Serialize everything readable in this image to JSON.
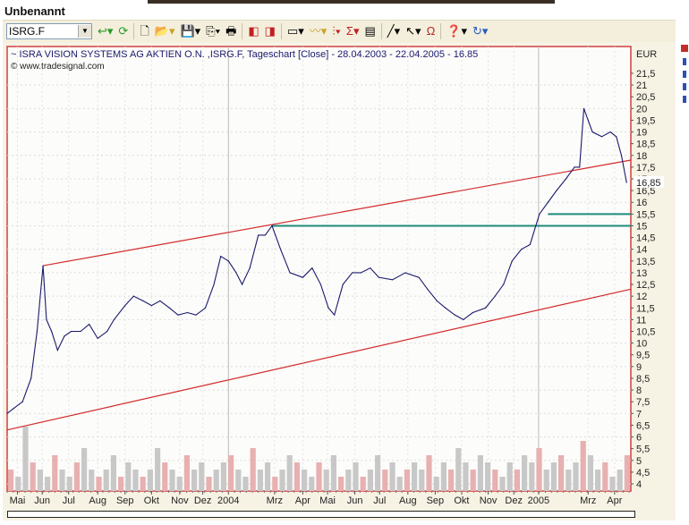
{
  "window": {
    "title": "Unbenannt"
  },
  "toolbar": {
    "symbol": "ISRG.F",
    "buttons": [
      "go",
      "refresh",
      "new",
      "open",
      "save",
      "copy",
      "print",
      "prev-chart",
      "next-chart",
      "layout",
      "indicator",
      "chart-type",
      "formula",
      "properties",
      "draw-line",
      "cursor",
      "magnet",
      "help",
      "undo"
    ]
  },
  "chart": {
    "title": "ISRA VISION SYSTEMS AG AKTIEN O.N. ,ISRG.F, Tageschart [Close] - 28.04.2003 - 22.04.2005 - 16.85",
    "source": "© www.tradesignal.com",
    "currency": "EUR",
    "last_value_label": "16,85"
  },
  "chart_data": {
    "type": "line",
    "title": "ISRA VISION SYSTEMS AG AKTIEN O.N. ,ISRG.F, Tageschart [Close]",
    "xlabel": "",
    "ylabel": "EUR",
    "ylim": [
      3.8,
      22.5
    ],
    "xlim_days": [
      0,
      730
    ],
    "yticks": [
      "21,5",
      "21",
      "20,5",
      "20",
      "19,5",
      "19",
      "18,5",
      "18",
      "17,5",
      "17",
      "16,5",
      "16",
      "15,5",
      "15",
      "14,5",
      "14",
      "13,5",
      "13",
      "12,5",
      "12",
      "11,5",
      "11",
      "10,5",
      "10",
      "9,5",
      "9",
      "8,5",
      "8",
      "7,5",
      "7",
      "6,5",
      "6",
      "5,5",
      "5",
      "4,5",
      "4"
    ],
    "xticks": [
      {
        "label": "Mai",
        "day": 12
      },
      {
        "label": "Jun",
        "day": 41
      },
      {
        "label": "Jul",
        "day": 72
      },
      {
        "label": "Aug",
        "day": 106
      },
      {
        "label": "Sep",
        "day": 138
      },
      {
        "label": "Okt",
        "day": 169
      },
      {
        "label": "Nov",
        "day": 202
      },
      {
        "label": "Dez",
        "day": 229
      },
      {
        "label": "2004",
        "day": 259
      },
      {
        "label": "Mrz",
        "day": 313
      },
      {
        "label": "Apr",
        "day": 346
      },
      {
        "label": "Mai",
        "day": 375
      },
      {
        "label": "Jun",
        "day": 407
      },
      {
        "label": "Jul",
        "day": 436
      },
      {
        "label": "Aug",
        "day": 469
      },
      {
        "label": "Sep",
        "day": 501
      },
      {
        "label": "Okt",
        "day": 532
      },
      {
        "label": "Nov",
        "day": 563
      },
      {
        "label": "Dez",
        "day": 593
      },
      {
        "label": "2005",
        "day": 622
      },
      {
        "label": "Mrz",
        "day": 680
      },
      {
        "label": "Apr",
        "day": 711
      }
    ],
    "series": [
      {
        "name": "Close",
        "color": "#1a1a6e",
        "points": [
          [
            0,
            7.0
          ],
          [
            7,
            7.2
          ],
          [
            18,
            7.5
          ],
          [
            28,
            8.5
          ],
          [
            35,
            10.5
          ],
          [
            42,
            13.3
          ],
          [
            46,
            11.0
          ],
          [
            52,
            10.5
          ],
          [
            59,
            9.7
          ],
          [
            67,
            10.3
          ],
          [
            75,
            10.5
          ],
          [
            86,
            10.5
          ],
          [
            96,
            10.8
          ],
          [
            106,
            10.2
          ],
          [
            117,
            10.5
          ],
          [
            125,
            11.0
          ],
          [
            138,
            11.6
          ],
          [
            148,
            12.0
          ],
          [
            159,
            11.8
          ],
          [
            169,
            11.6
          ],
          [
            179,
            11.8
          ],
          [
            190,
            11.5
          ],
          [
            200,
            11.2
          ],
          [
            211,
            11.3
          ],
          [
            221,
            11.2
          ],
          [
            232,
            11.5
          ],
          [
            242,
            12.5
          ],
          [
            250,
            13.7
          ],
          [
            259,
            13.5
          ],
          [
            268,
            13.0
          ],
          [
            275,
            12.5
          ],
          [
            284,
            13.2
          ],
          [
            294,
            14.6
          ],
          [
            302,
            14.6
          ],
          [
            310,
            15.0
          ],
          [
            320,
            14.0
          ],
          [
            331,
            13.0
          ],
          [
            346,
            12.8
          ],
          [
            357,
            13.2
          ],
          [
            367,
            12.5
          ],
          [
            376,
            11.5
          ],
          [
            383,
            11.2
          ],
          [
            393,
            12.5
          ],
          [
            404,
            13.0
          ],
          [
            414,
            13.0
          ],
          [
            425,
            13.2
          ],
          [
            435,
            12.8
          ],
          [
            451,
            12.7
          ],
          [
            466,
            13.0
          ],
          [
            482,
            12.8
          ],
          [
            492,
            12.3
          ],
          [
            503,
            11.8
          ],
          [
            513,
            11.5
          ],
          [
            524,
            11.2
          ],
          [
            534,
            11.0
          ],
          [
            545,
            11.3
          ],
          [
            560,
            11.5
          ],
          [
            571,
            12.0
          ],
          [
            581,
            12.5
          ],
          [
            591,
            13.5
          ],
          [
            602,
            14.0
          ],
          [
            612,
            14.2
          ],
          [
            623,
            15.5
          ],
          [
            633,
            16.0
          ],
          [
            643,
            16.5
          ],
          [
            654,
            17.0
          ],
          [
            664,
            17.5
          ],
          [
            670,
            17.5
          ],
          [
            675,
            20.0
          ],
          [
            680,
            19.5
          ],
          [
            685,
            19.0
          ],
          [
            696,
            18.8
          ],
          [
            706,
            19.0
          ],
          [
            713,
            18.8
          ],
          [
            719,
            18.0
          ],
          [
            725,
            16.85
          ]
        ]
      }
    ],
    "trendlines": [
      {
        "name": "upper-channel",
        "color": "#d22a2a",
        "from": [
          42,
          13.3
        ],
        "to": [
          730,
          17.8
        ]
      },
      {
        "name": "lower-channel",
        "color": "#d22a2a",
        "from": [
          0,
          6.3
        ],
        "to": [
          730,
          12.3
        ]
      },
      {
        "name": "resistance-15",
        "color": "#1f8a7a",
        "from": [
          310,
          15.0
        ],
        "to": [
          730,
          15.0
        ]
      },
      {
        "name": "support-15.5",
        "color": "#1f8a7a",
        "from": [
          633,
          15.5
        ],
        "to": [
          730,
          15.5
        ]
      }
    ],
    "volume_relative": [
      3,
      2,
      9,
      4,
      3,
      2,
      5,
      3,
      2,
      4,
      6,
      3,
      2,
      3,
      5,
      2,
      4,
      3,
      2,
      3,
      6,
      4,
      3,
      2,
      5,
      3,
      4,
      2,
      3,
      4,
      5,
      3,
      2,
      6,
      3,
      4,
      2,
      3,
      5,
      4,
      3,
      2,
      4,
      3,
      5,
      2,
      3,
      4,
      2,
      3,
      5,
      3,
      4,
      2,
      3,
      4,
      3,
      5,
      2,
      4,
      3,
      6,
      4,
      3,
      5,
      4,
      3,
      2,
      4,
      3,
      5,
      4,
      6,
      3,
      4,
      5,
      3,
      4,
      7,
      5,
      3,
      4,
      2,
      3,
      5
    ]
  }
}
